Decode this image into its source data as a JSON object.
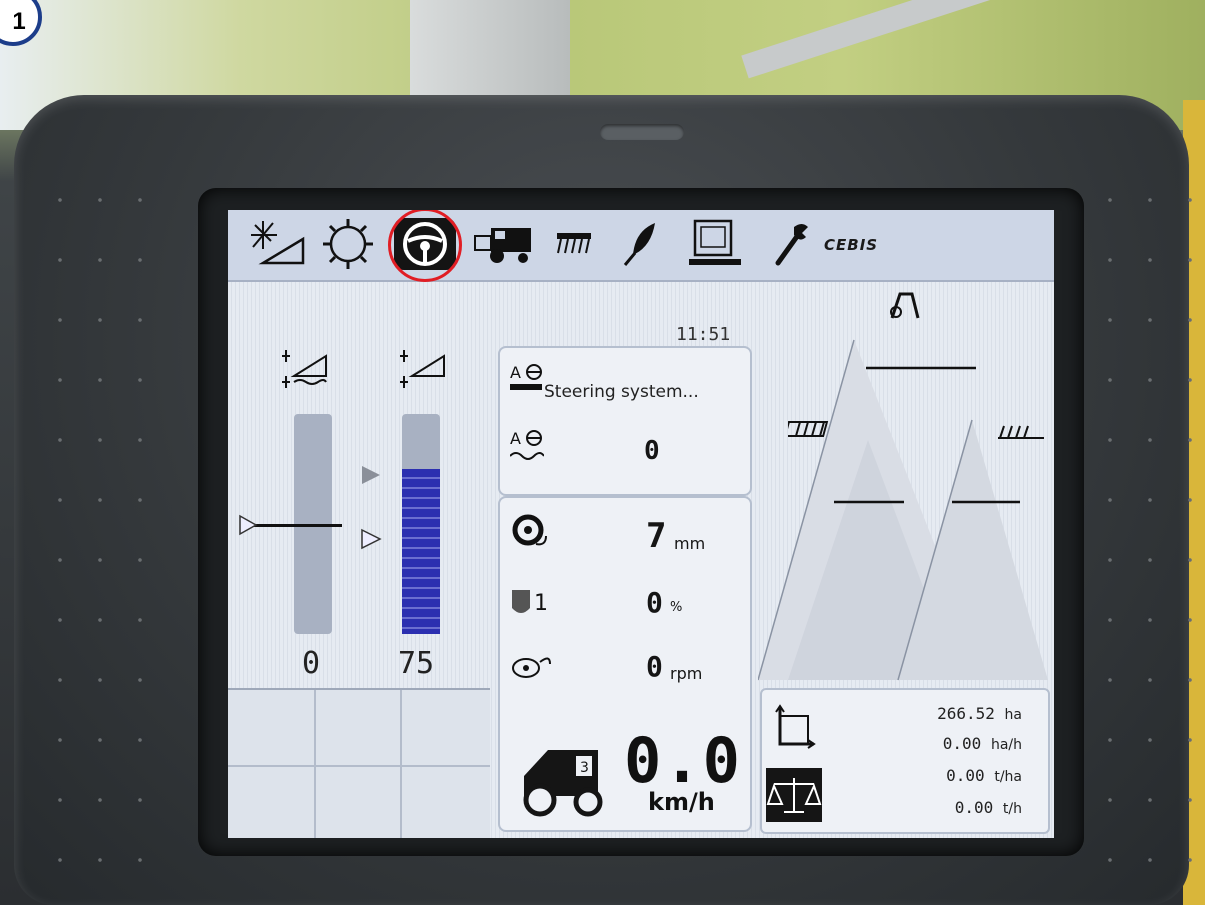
{
  "badge": {
    "number": "1"
  },
  "toolbar": {
    "tabs": [
      {
        "id": "lighting",
        "icon": "light-sensor-icon"
      },
      {
        "id": "settings",
        "icon": "gear-icon"
      },
      {
        "id": "steering",
        "icon": "steering-wheel-icon",
        "active": true
      },
      {
        "id": "harvester",
        "icon": "combine-harvester-icon"
      },
      {
        "id": "header",
        "icon": "header-attachment-icon"
      },
      {
        "id": "crop",
        "icon": "grain-ear-icon"
      },
      {
        "id": "terminal",
        "icon": "computer-monitor-icon"
      },
      {
        "id": "service",
        "icon": "wrench-icon"
      }
    ],
    "brand": "CEBIS"
  },
  "left": {
    "gauge1_value": "0",
    "gauge2_value": "75",
    "gauge2_fill_percent": 75
  },
  "center": {
    "clock": "11:51",
    "steering_status": "Steering system...",
    "steering_value": "0",
    "rotor_value": "7",
    "rotor_unit": "mm",
    "grain_loss_value": "0",
    "grain_loss_unit": "%",
    "engine_value": "0",
    "engine_unit": "rpm",
    "speed_value": "0.0",
    "speed_unit": "km/h"
  },
  "right": {
    "area_total": "266.52",
    "area_total_unit": "ha",
    "area_rate": "0.00",
    "area_rate_unit": "ha/h",
    "yield_per_area": "0.00",
    "yield_per_area_unit": "t/ha",
    "yield_per_hour": "0.00",
    "yield_per_hour_unit": "t/h"
  },
  "colors": {
    "accent_bar": "#2b2fb0",
    "active_ring": "#e11d24",
    "badge_border": "#1c3d8a"
  }
}
